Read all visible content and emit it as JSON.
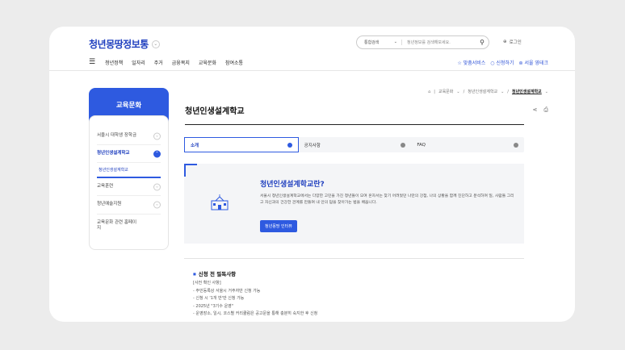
{
  "header": {
    "logo": "청년몽땅정보통",
    "search_select": "통합검색",
    "search_placeholder": "청년정보를 검색해보세요.",
    "login": "로그인"
  },
  "nav": {
    "items": [
      "청년정책",
      "일자리",
      "주거",
      "금융복지",
      "교육문화",
      "참여소통"
    ],
    "utils": [
      "맞춤서비스",
      "신청하기",
      "서울 영테크"
    ]
  },
  "sidebar": {
    "title": "교육문화",
    "items": [
      {
        "label": "서울시 대학생 장학금"
      },
      {
        "label": "청년인생설계학교"
      },
      {
        "label": "교육훈련"
      },
      {
        "label": "청년예술지원"
      },
      {
        "label": "교육문화 관련 홈페이지"
      }
    ],
    "sub": "청년인생설계학교"
  },
  "breadcrumb": [
    "교육문화",
    "청년인생설계학교",
    "청년인생설계학교"
  ],
  "page": {
    "title": "청년인생설계학교",
    "tabs": [
      "소개",
      "공지사항",
      "FAQ"
    ]
  },
  "intro": {
    "heading": "청년인생설계학교란?",
    "body": "서울시 청년인생설계학교에서는 다양한 고민을 가진 청년들이 모여 혼자서는 찾기 어려웠던 나만의 강점, 나의 상황을 함께 진단하고 분석하여 일, 사람들 그리고 자신과의 건강한 관계를 만들며 내 안의 답을 찾아가는 법을 배웁니다.",
    "button": "청년몽땅 인터뷰"
  },
  "notes": {
    "heading": "신청 전 필독사항",
    "lines": [
      "[사전 확인 사항]",
      "- 주민등록상 서울시 거주자만 신청 가능",
      "- 신청 시 '1개 반'만 신청 가능",
      "- 2025년 \"3기수 운영\"",
      "- 운영장소, 일시, 코스별 커리큘럼은 공고문을 통해 충분히 숙지한 후 신청"
    ]
  },
  "colors": {
    "accent": "#2e5ae0",
    "logo_green": "#8bd64b"
  }
}
